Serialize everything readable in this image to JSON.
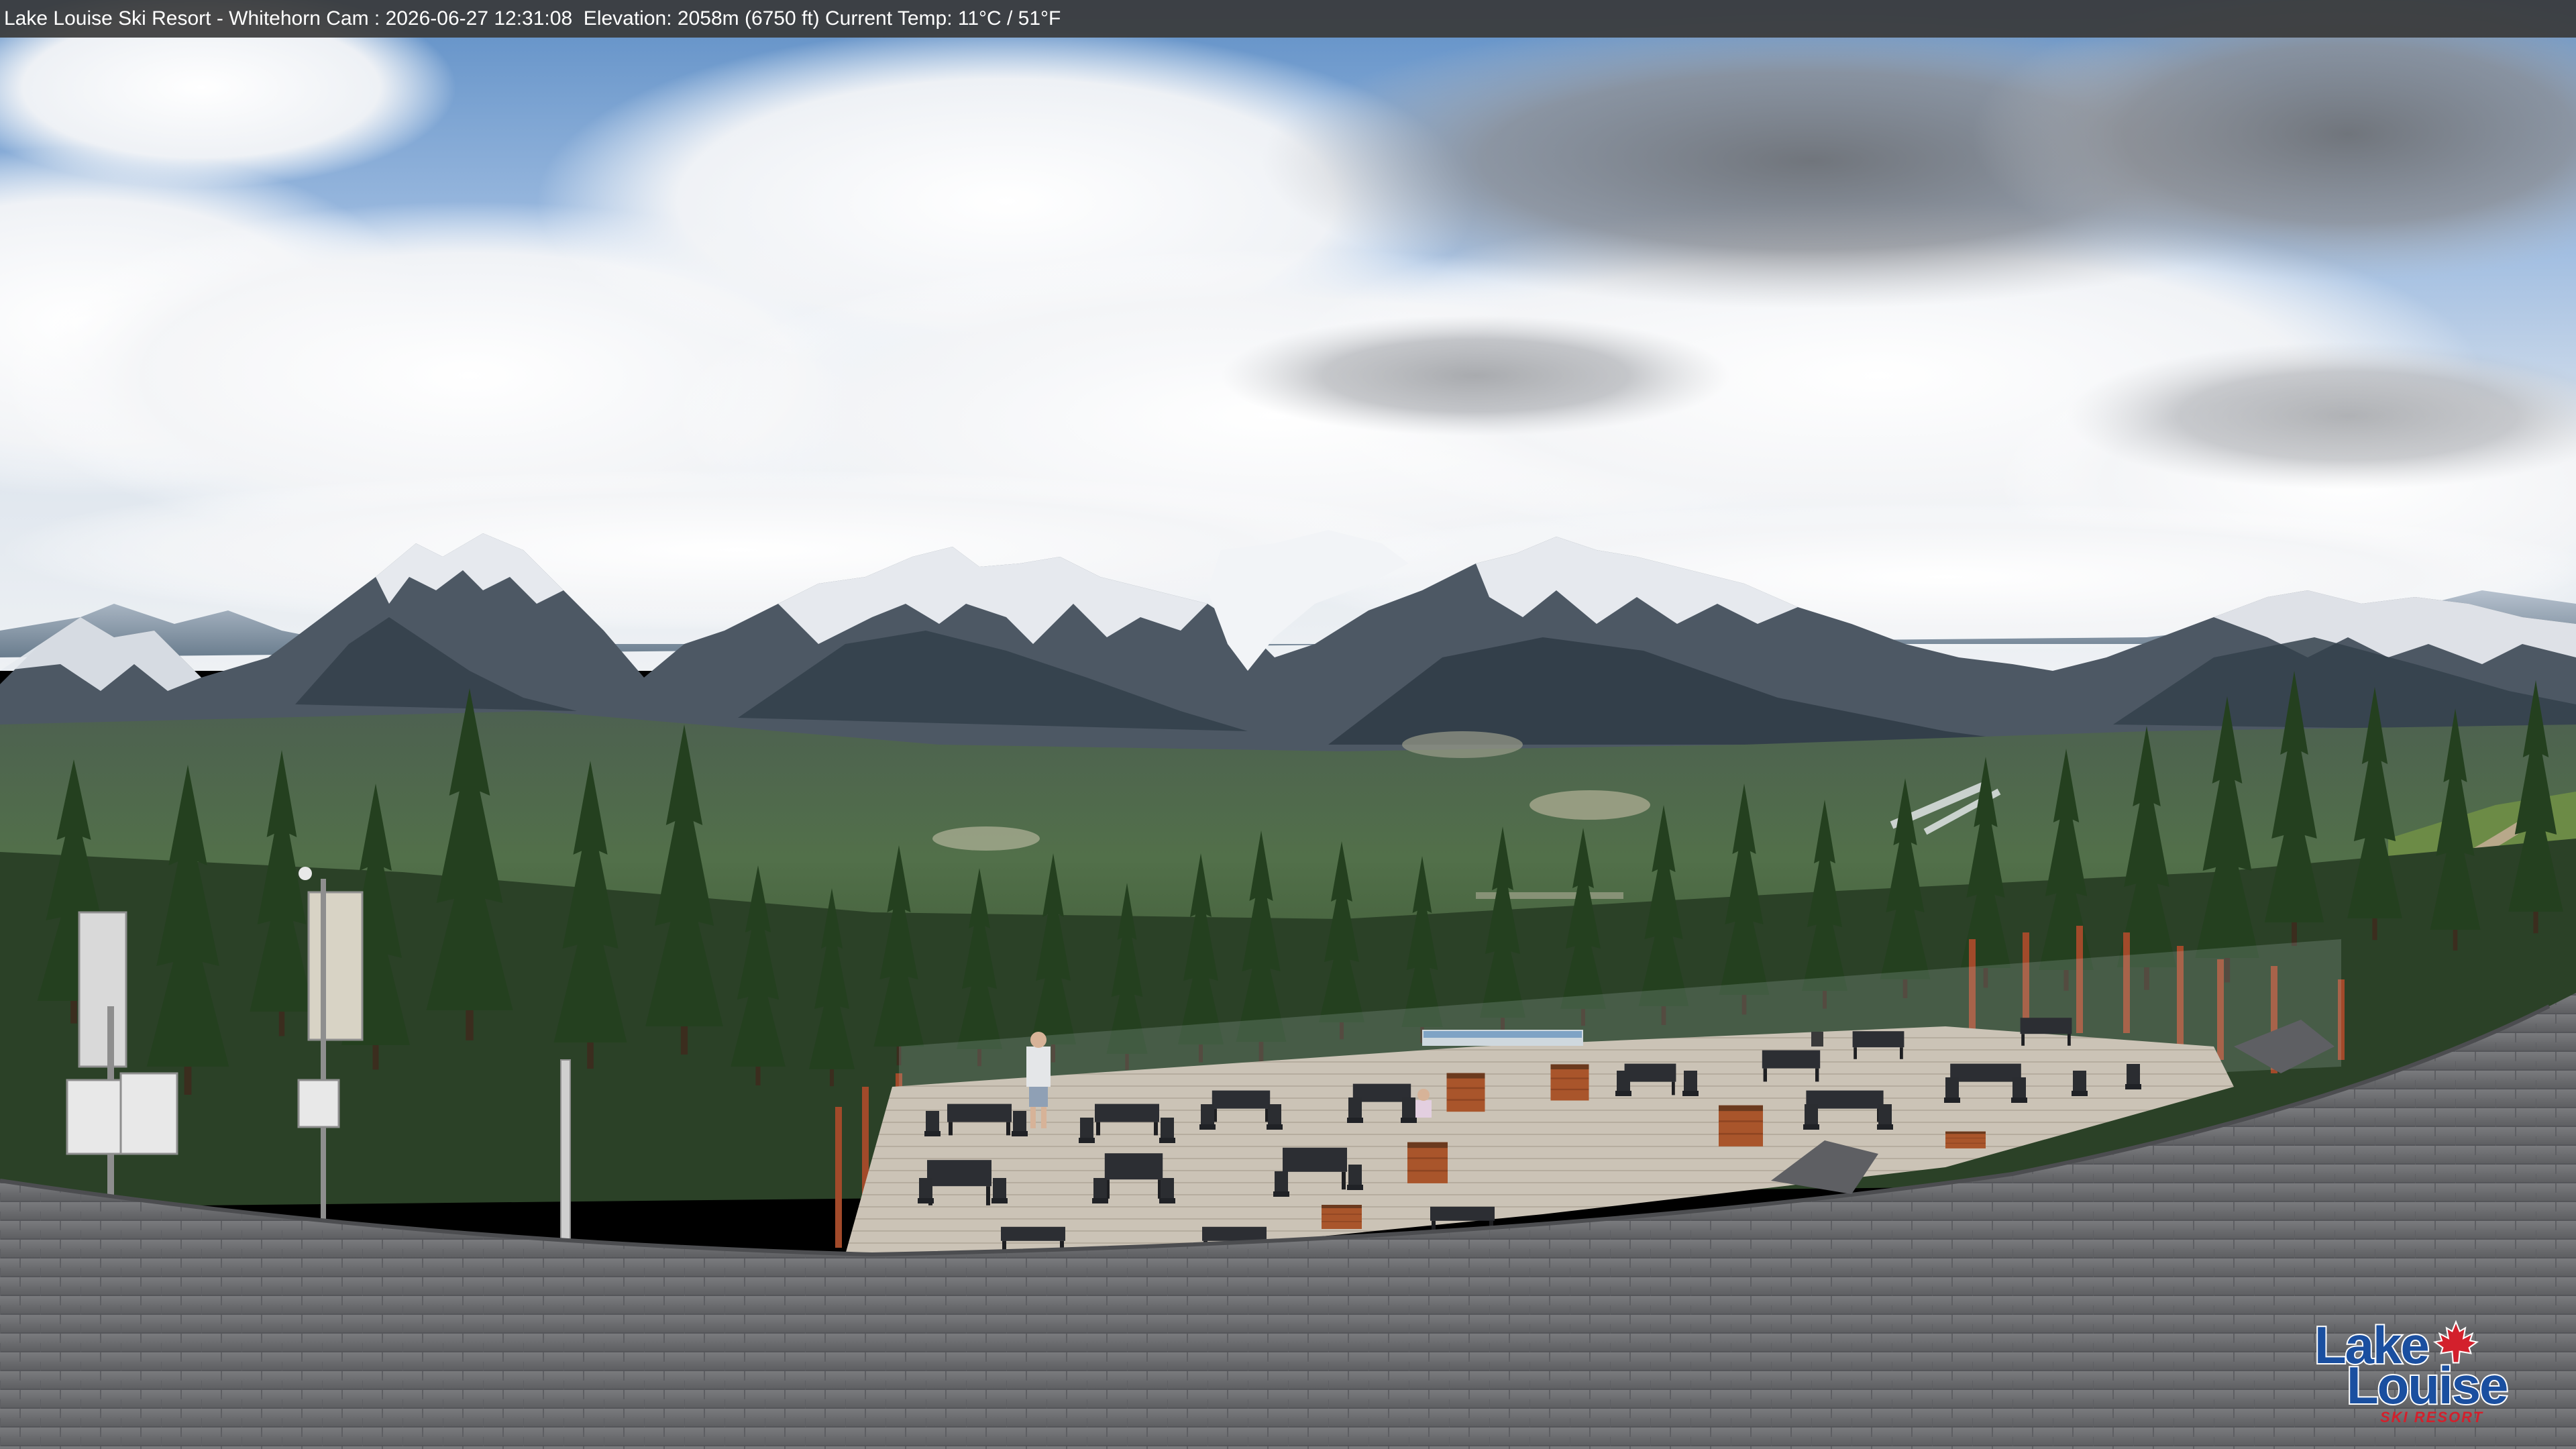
{
  "webcam": {
    "overlay_text": "Lake Louise Ski Resort - Whitehorn Cam : 2026-06-27 12:31:08  Elevation: 2058m (6750 ft) Current Temp: 11°C / 51°F"
  },
  "logo": {
    "word1": "Lake",
    "word2": "Louise",
    "subtitle": "SKI RESORT",
    "icon": "maple-leaf-icon"
  },
  "colors": {
    "overlay_bg": "#3a3a3a",
    "logo_blue": "#1a4fa0",
    "logo_red": "#d3202c",
    "sky": "#7aa6d6",
    "roof": "#6e6e70",
    "deck": "#c9c1b5",
    "forest": "#2f4a2e"
  }
}
